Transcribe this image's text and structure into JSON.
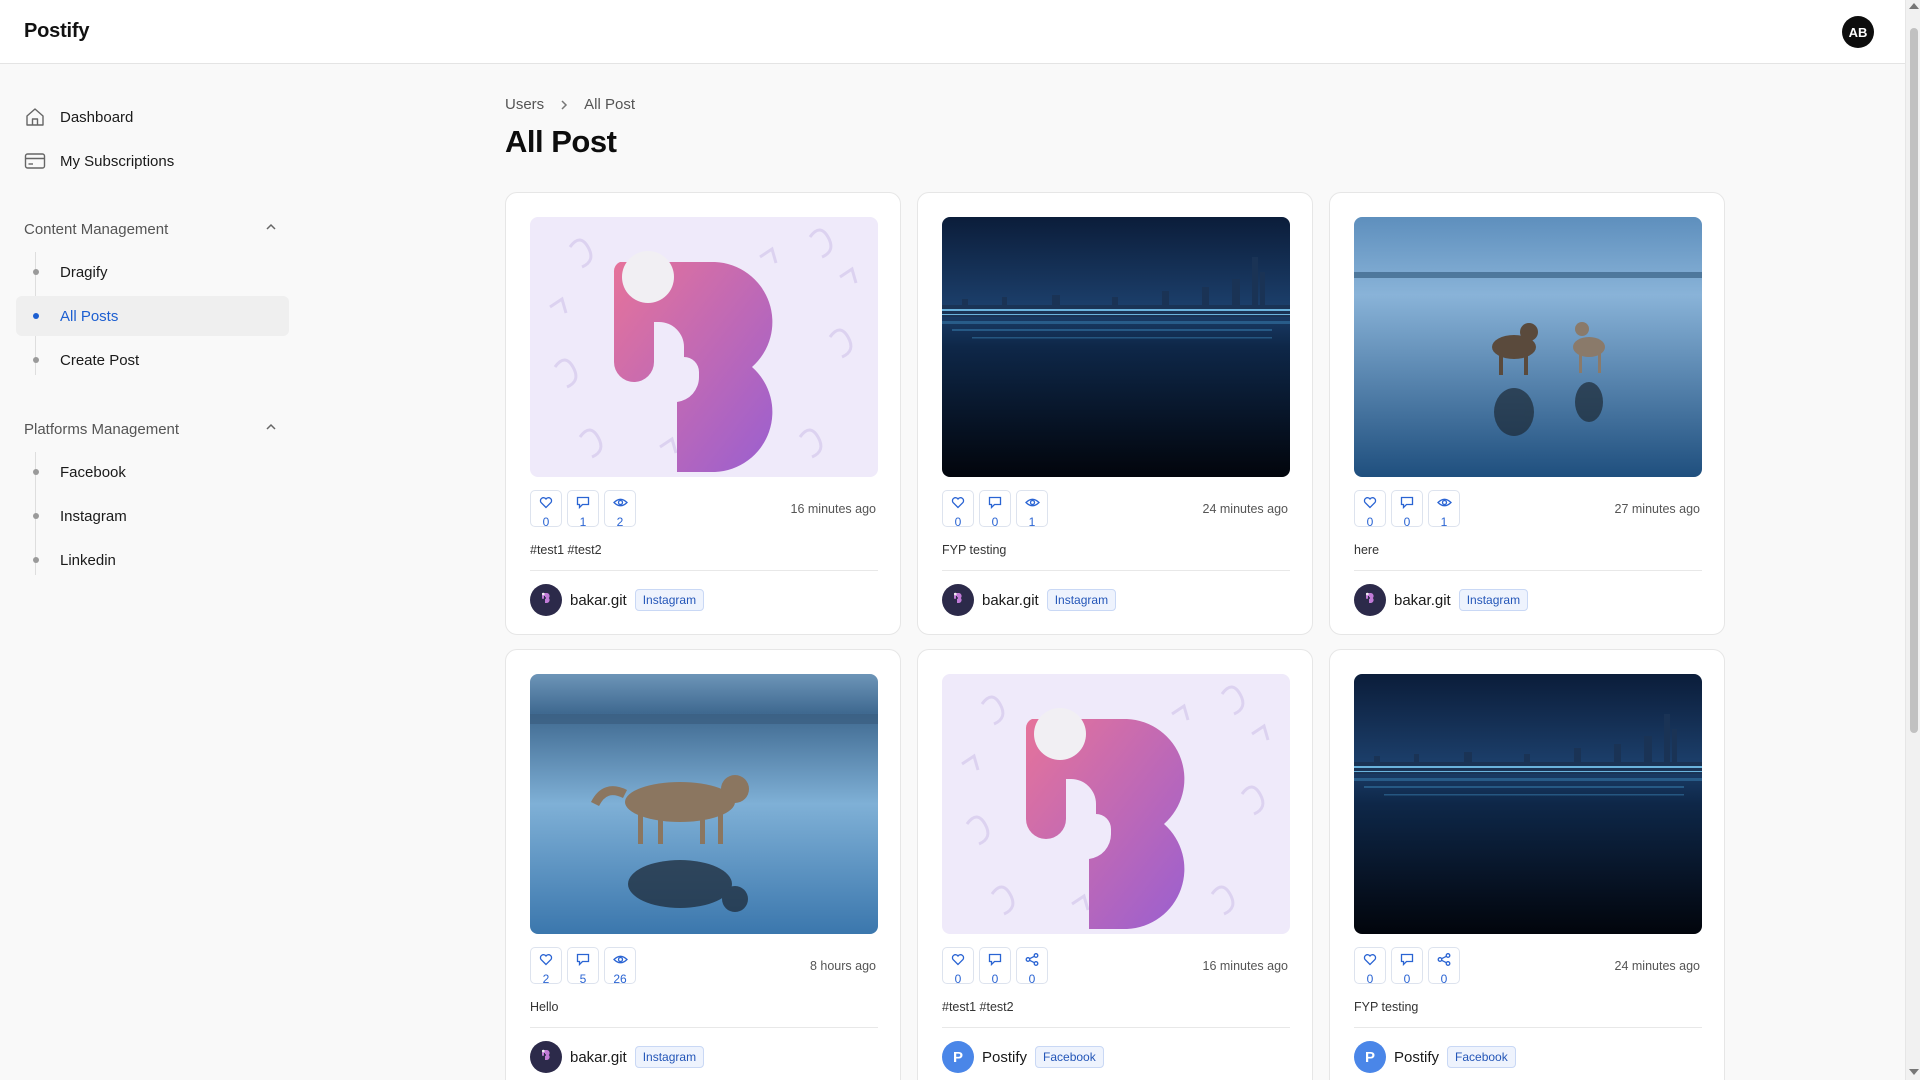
{
  "app": {
    "name": "Postify",
    "user_initials": "AB"
  },
  "sidebar": {
    "top_items": [
      {
        "label": "Dashboard",
        "icon": "home-icon"
      },
      {
        "label": "My Subscriptions",
        "icon": "card-icon"
      }
    ],
    "sections": [
      {
        "title": "Content Management",
        "expanded": true,
        "items": [
          {
            "label": "Dragify",
            "active": false
          },
          {
            "label": "All Posts",
            "active": true
          },
          {
            "label": "Create Post",
            "active": false
          }
        ]
      },
      {
        "title": "Platforms Management",
        "expanded": true,
        "items": [
          {
            "label": "Facebook",
            "active": false
          },
          {
            "label": "Instagram",
            "active": false
          },
          {
            "label": "Linkedin",
            "active": false
          }
        ]
      }
    ]
  },
  "breadcrumb": {
    "parent": "Users",
    "current": "All Post"
  },
  "page_title": "All Post",
  "posts": [
    {
      "image": "logo-b",
      "likes": "0",
      "comments": "1",
      "third": "2",
      "third_icon": "eye-icon",
      "time": "16 minutes ago",
      "caption": "#test1 #test2",
      "author": "bakar.git",
      "avatar": "logo",
      "platform": "Instagram"
    },
    {
      "image": "night-city",
      "likes": "0",
      "comments": "0",
      "third": "1",
      "third_icon": "eye-icon",
      "time": "24 minutes ago",
      "caption": "FYP testing",
      "author": "bakar.git",
      "avatar": "logo",
      "platform": "Instagram"
    },
    {
      "image": "two-dogs",
      "likes": "0",
      "comments": "0",
      "third": "1",
      "third_icon": "eye-icon",
      "time": "27 minutes ago",
      "caption": "here",
      "author": "bakar.git",
      "avatar": "logo",
      "platform": "Instagram"
    },
    {
      "image": "husky-walking",
      "likes": "2",
      "comments": "5",
      "third": "26",
      "third_icon": "eye-icon",
      "time": "8 hours ago",
      "caption": "Hello",
      "author": "bakar.git",
      "avatar": "logo",
      "platform": "Instagram"
    },
    {
      "image": "logo-b",
      "likes": "0",
      "comments": "0",
      "third": "0",
      "third_icon": "share-icon",
      "time": "16 minutes ago",
      "caption": "#test1 #test2",
      "author": "Postify",
      "avatar": "P",
      "platform": "Facebook"
    },
    {
      "image": "night-city",
      "likes": "0",
      "comments": "0",
      "third": "0",
      "third_icon": "share-icon",
      "time": "24 minutes ago",
      "caption": "FYP testing",
      "author": "Postify",
      "avatar": "P",
      "platform": "Facebook"
    }
  ]
}
